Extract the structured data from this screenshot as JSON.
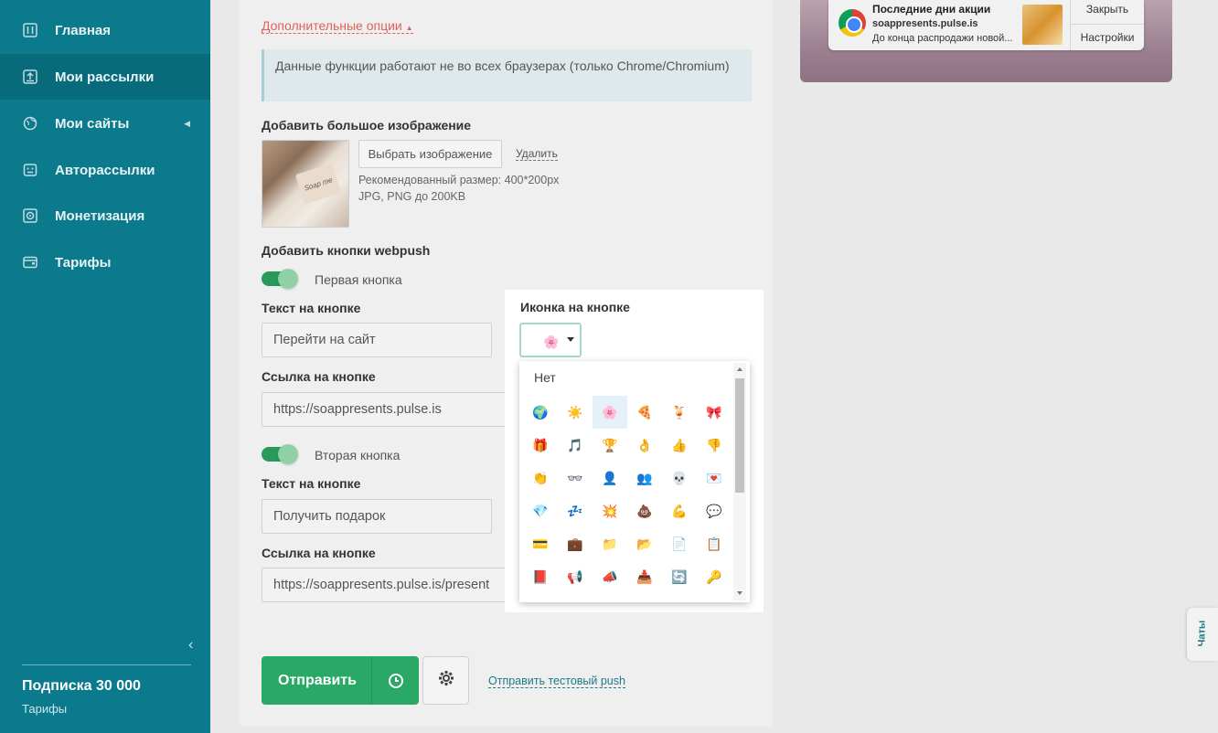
{
  "sidebar": {
    "items": [
      {
        "label": "Главная",
        "icon": "sliders-icon"
      },
      {
        "label": "Мои рассылки",
        "icon": "upload-box-icon"
      },
      {
        "label": "Мои сайты",
        "icon": "globe-icon"
      },
      {
        "label": "Авторассылки",
        "icon": "robot-icon"
      },
      {
        "label": "Монетизация",
        "icon": "target-icon"
      },
      {
        "label": "Тарифы",
        "icon": "wallet-icon"
      }
    ],
    "subscription_title": "Подписка 30 000",
    "subscription_link": "Тарифы"
  },
  "form": {
    "extra_options": "Дополнительные опции",
    "notice": "Данные функции работают не во всех браузерах (только Chrome/Chromium)",
    "big_image_label": "Добавить большое изображение",
    "choose_image": "Выбрать изображение",
    "delete": "Удалить",
    "thumb_text": "Soap me",
    "hint_size": "Рекомендованный размер: 400*200px",
    "hint_format": "JPG, PNG до 200KB",
    "webpush_label": "Добавить кнопки webpush",
    "first_button": "Первая кнопка",
    "second_button": "Вторая кнопка",
    "button_text_label": "Текст на кнопке",
    "button_link_label": "Ссылка на кнопке",
    "first_text_value": "Перейти на сайт",
    "first_link_value": "https://soappresents.pulse.is",
    "second_text_value": "Получить подарок",
    "second_link_value": "https://soappresents.pulse.is/present",
    "send": "Отправить",
    "test_push": "Отправить тестовый push"
  },
  "icon_picker": {
    "label": "Иконка на кнопке",
    "selected": "🌸",
    "none_option": "Нет",
    "emojis": [
      "🌍",
      "☀️",
      "🌸",
      "🍕",
      "🍹",
      "🎀",
      "🎁",
      "🎵",
      "🏆",
      "👌",
      "👍",
      "👎",
      "👏",
      "👓",
      "👤",
      "👥",
      "💀",
      "💌",
      "💎",
      "💤",
      "💥",
      "💩",
      "💪",
      "💬",
      "💳",
      "💼",
      "📁",
      "📂",
      "📄",
      "📋",
      "📕",
      "📢",
      "📣",
      "📥",
      "🔄",
      "🔑"
    ],
    "selected_index": 2
  },
  "notification": {
    "title": "Последние дни акции",
    "site": "soappresents.pulse.is",
    "body": "До конца распродажи новой...",
    "close": "Закрыть",
    "settings": "Настройки"
  },
  "chats": "Чаты"
}
